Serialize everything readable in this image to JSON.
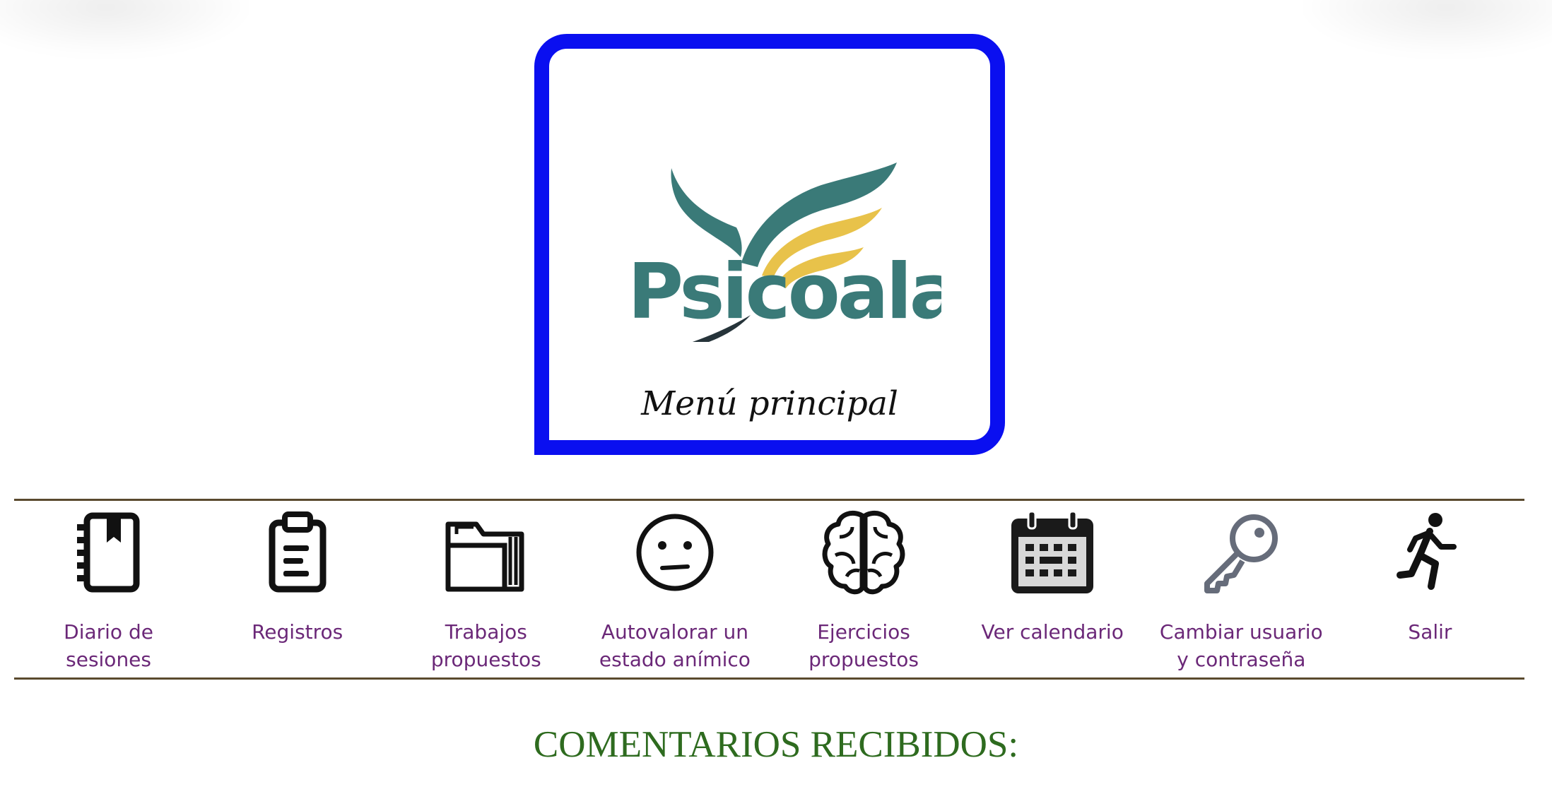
{
  "logo": {
    "brand_text": "Psicoalas",
    "caption": "Menú principal",
    "colors": {
      "frame": "#0a0ff0",
      "teal": "#3a7a78",
      "gold": "#e8c24a",
      "dark": "#26343a"
    }
  },
  "nav": {
    "items": [
      {
        "label": "Diario de\nsesiones",
        "icon": "notebook-icon"
      },
      {
        "label": "Registros",
        "icon": "clipboard-icon"
      },
      {
        "label": "Trabajos\npropuestos",
        "icon": "folder-icon"
      },
      {
        "label": "Autovalorar un\nestado anímico",
        "icon": "neutral-face-icon"
      },
      {
        "label": "Ejercicios\npropuestos",
        "icon": "brain-icon"
      },
      {
        "label": "Ver calendario",
        "icon": "calendar-icon"
      },
      {
        "label": "Cambiar usuario\ny contraseña",
        "icon": "key-icon"
      },
      {
        "label": "Salir",
        "icon": "running-person-icon"
      }
    ],
    "label_color": "#6b2878",
    "rule_color": "#5a4a2e"
  },
  "comments": {
    "title": "COMENTARIOS RECIBIDOS:",
    "color": "#2e6b1f"
  }
}
